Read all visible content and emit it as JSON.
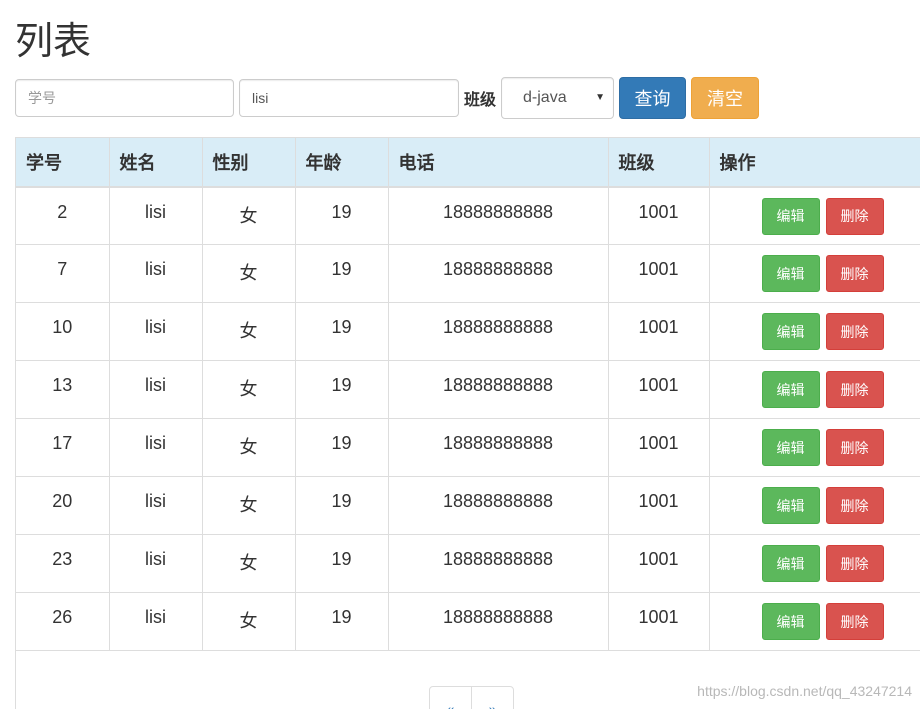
{
  "page": {
    "title": "列表"
  },
  "search": {
    "id_placeholder": "学号",
    "id_value": "",
    "name_value": "lisi",
    "class_label": "班级",
    "class_selected": "d-java",
    "query_label": "查询",
    "clear_label": "清空"
  },
  "table": {
    "columns": [
      "学号",
      "姓名",
      "性别",
      "年龄",
      "电话",
      "班级",
      "操作"
    ],
    "edit_label": "编辑",
    "delete_label": "删除",
    "rows": [
      {
        "id": "2",
        "name": "lisi",
        "gender": "女",
        "age": "19",
        "phone": "18888888888",
        "class": "1001"
      },
      {
        "id": "7",
        "name": "lisi",
        "gender": "女",
        "age": "19",
        "phone": "18888888888",
        "class": "1001"
      },
      {
        "id": "10",
        "name": "lisi",
        "gender": "女",
        "age": "19",
        "phone": "18888888888",
        "class": "1001"
      },
      {
        "id": "13",
        "name": "lisi",
        "gender": "女",
        "age": "19",
        "phone": "18888888888",
        "class": "1001"
      },
      {
        "id": "17",
        "name": "lisi",
        "gender": "女",
        "age": "19",
        "phone": "18888888888",
        "class": "1001"
      },
      {
        "id": "20",
        "name": "lisi",
        "gender": "女",
        "age": "19",
        "phone": "18888888888",
        "class": "1001"
      },
      {
        "id": "23",
        "name": "lisi",
        "gender": "女",
        "age": "19",
        "phone": "18888888888",
        "class": "1001"
      },
      {
        "id": "26",
        "name": "lisi",
        "gender": "女",
        "age": "19",
        "phone": "18888888888",
        "class": "1001"
      }
    ]
  },
  "pagination": {
    "prev_label": "«",
    "next_label": "»"
  },
  "watermark": "https://blog.csdn.net/qq_43247214",
  "colors": {
    "primary": "#337ab7",
    "warning": "#f0ad4e",
    "success": "#5cb85c",
    "danger": "#d9534f",
    "table_header": "#d9edf7"
  }
}
